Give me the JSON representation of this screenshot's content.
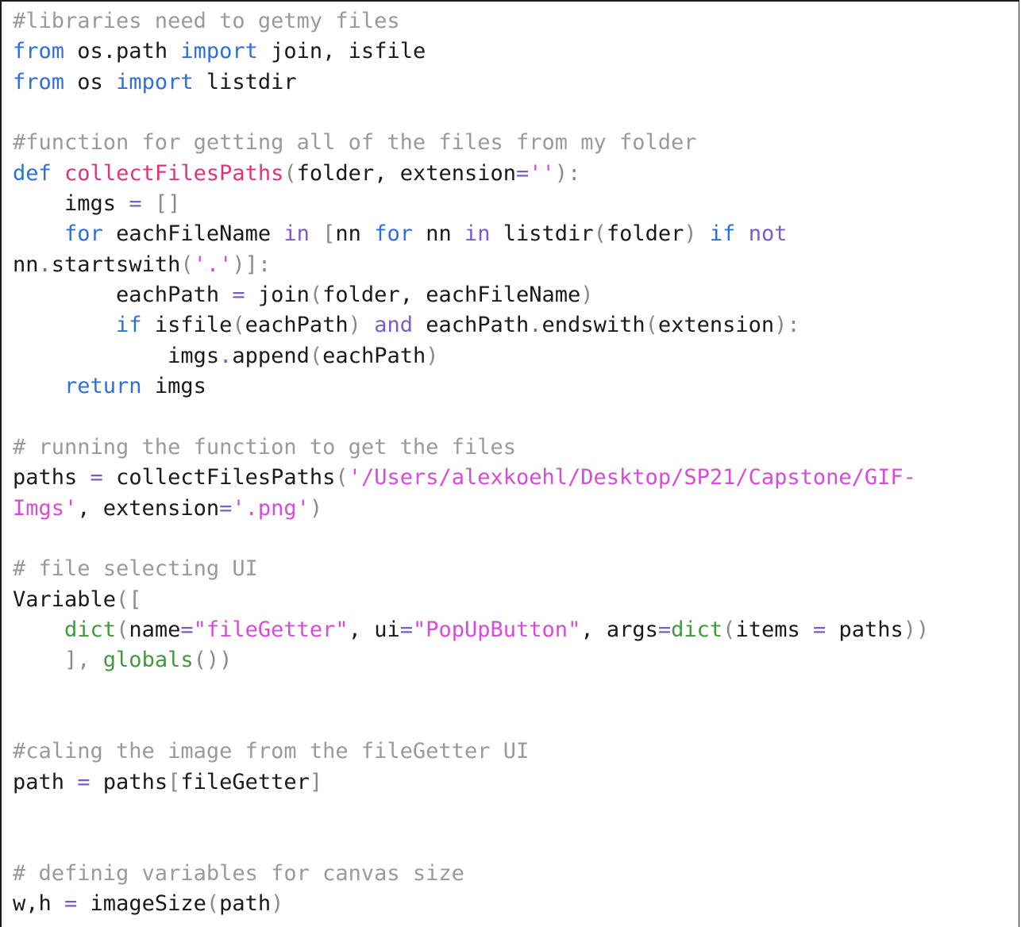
{
  "editor": {
    "lines": [
      [
        {
          "t": "#libraries need to getmy files",
          "c": "comment"
        }
      ],
      [
        {
          "t": "from",
          "c": "keyword"
        },
        {
          "t": " os.path ",
          "c": "plain"
        },
        {
          "t": "import",
          "c": "keyword"
        },
        {
          "t": " join, isfile",
          "c": "plain"
        }
      ],
      [
        {
          "t": "from",
          "c": "keyword"
        },
        {
          "t": " os ",
          "c": "plain"
        },
        {
          "t": "import",
          "c": "keyword"
        },
        {
          "t": " listdir",
          "c": "plain"
        }
      ],
      [],
      [
        {
          "t": "#function for getting all of the files from my folder",
          "c": "comment"
        }
      ],
      [
        {
          "t": "def",
          "c": "keyword"
        },
        {
          "t": " ",
          "c": "plain"
        },
        {
          "t": "collectFilesPaths",
          "c": "funcdef"
        },
        {
          "t": "(",
          "c": "punct"
        },
        {
          "t": "folder, extension",
          "c": "plain"
        },
        {
          "t": "=",
          "c": "op"
        },
        {
          "t": "''",
          "c": "string"
        },
        {
          "t": "):",
          "c": "punct"
        }
      ],
      [
        {
          "t": "    imgs ",
          "c": "plain"
        },
        {
          "t": "=",
          "c": "op"
        },
        {
          "t": " []",
          "c": "punct"
        }
      ],
      [
        {
          "t": "    ",
          "c": "plain"
        },
        {
          "t": "for",
          "c": "keyword"
        },
        {
          "t": " eachFileName ",
          "c": "plain"
        },
        {
          "t": "in",
          "c": "op"
        },
        {
          "t": " [",
          "c": "punct"
        },
        {
          "t": "nn ",
          "c": "plain"
        },
        {
          "t": "for",
          "c": "keyword"
        },
        {
          "t": " nn ",
          "c": "plain"
        },
        {
          "t": "in",
          "c": "op"
        },
        {
          "t": " listdir",
          "c": "plain"
        },
        {
          "t": "(",
          "c": "punct"
        },
        {
          "t": "folder",
          "c": "plain"
        },
        {
          "t": ") ",
          "c": "punct"
        },
        {
          "t": "if",
          "c": "keyword"
        },
        {
          "t": " ",
          "c": "plain"
        },
        {
          "t": "not",
          "c": "op"
        }
      ],
      [
        {
          "t": "nn",
          "c": "plain"
        },
        {
          "t": ".",
          "c": "op"
        },
        {
          "t": "startswith",
          "c": "plain"
        },
        {
          "t": "(",
          "c": "punct"
        },
        {
          "t": "'.'",
          "c": "string"
        },
        {
          "t": ")]:",
          "c": "punct"
        }
      ],
      [
        {
          "t": "        eachPath ",
          "c": "plain"
        },
        {
          "t": "=",
          "c": "op"
        },
        {
          "t": " join",
          "c": "plain"
        },
        {
          "t": "(",
          "c": "punct"
        },
        {
          "t": "folder, eachFileName",
          "c": "plain"
        },
        {
          "t": ")",
          "c": "punct"
        }
      ],
      [
        {
          "t": "        ",
          "c": "plain"
        },
        {
          "t": "if",
          "c": "keyword"
        },
        {
          "t": " isfile",
          "c": "plain"
        },
        {
          "t": "(",
          "c": "punct"
        },
        {
          "t": "eachPath",
          "c": "plain"
        },
        {
          "t": ") ",
          "c": "punct"
        },
        {
          "t": "and",
          "c": "op"
        },
        {
          "t": " eachPath",
          "c": "plain"
        },
        {
          "t": ".",
          "c": "op"
        },
        {
          "t": "endswith",
          "c": "plain"
        },
        {
          "t": "(",
          "c": "punct"
        },
        {
          "t": "extension",
          "c": "plain"
        },
        {
          "t": "):",
          "c": "punct"
        }
      ],
      [
        {
          "t": "            imgs",
          "c": "plain"
        },
        {
          "t": ".",
          "c": "op"
        },
        {
          "t": "append",
          "c": "plain"
        },
        {
          "t": "(",
          "c": "punct"
        },
        {
          "t": "eachPath",
          "c": "plain"
        },
        {
          "t": ")",
          "c": "punct"
        }
      ],
      [
        {
          "t": "    ",
          "c": "plain"
        },
        {
          "t": "return",
          "c": "keyword"
        },
        {
          "t": " imgs",
          "c": "plain"
        }
      ],
      [],
      [
        {
          "t": "# running the function to get the files",
          "c": "comment"
        }
      ],
      [
        {
          "t": "paths ",
          "c": "plain"
        },
        {
          "t": "=",
          "c": "op"
        },
        {
          "t": " collectFilesPaths",
          "c": "plain"
        },
        {
          "t": "(",
          "c": "punct"
        },
        {
          "t": "'/Users/alexkoehl/Desktop/SP21/Capstone/GIF-",
          "c": "string"
        }
      ],
      [
        {
          "t": "Imgs'",
          "c": "string"
        },
        {
          "t": ", extension",
          "c": "plain"
        },
        {
          "t": "=",
          "c": "op"
        },
        {
          "t": "'.png'",
          "c": "string"
        },
        {
          "t": ")",
          "c": "punct"
        }
      ],
      [],
      [
        {
          "t": "# file selecting UI",
          "c": "comment"
        }
      ],
      [
        {
          "t": "Variable",
          "c": "plain"
        },
        {
          "t": "([",
          "c": "punct"
        }
      ],
      [
        {
          "t": "    ",
          "c": "plain"
        },
        {
          "t": "dict",
          "c": "builtin"
        },
        {
          "t": "(",
          "c": "punct"
        },
        {
          "t": "name",
          "c": "plain"
        },
        {
          "t": "=",
          "c": "op"
        },
        {
          "t": "\"fileGetter\"",
          "c": "string"
        },
        {
          "t": ", ui",
          "c": "plain"
        },
        {
          "t": "=",
          "c": "op"
        },
        {
          "t": "\"PopUpButton\"",
          "c": "string"
        },
        {
          "t": ", args",
          "c": "plain"
        },
        {
          "t": "=",
          "c": "op"
        },
        {
          "t": "dict",
          "c": "builtin"
        },
        {
          "t": "(",
          "c": "punct"
        },
        {
          "t": "items ",
          "c": "plain"
        },
        {
          "t": "=",
          "c": "op"
        },
        {
          "t": " paths",
          "c": "plain"
        },
        {
          "t": "))",
          "c": "punct"
        }
      ],
      [
        {
          "t": "    ], ",
          "c": "punct"
        },
        {
          "t": "globals",
          "c": "builtin"
        },
        {
          "t": "())",
          "c": "punct"
        }
      ],
      [],
      [],
      [
        {
          "t": "#caling the image from the fileGetter UI",
          "c": "comment"
        }
      ],
      [
        {
          "t": "path ",
          "c": "plain"
        },
        {
          "t": "=",
          "c": "op"
        },
        {
          "t": " paths",
          "c": "plain"
        },
        {
          "t": "[",
          "c": "punct"
        },
        {
          "t": "fileGetter",
          "c": "plain"
        },
        {
          "t": "]",
          "c": "punct"
        }
      ],
      [],
      [],
      [
        {
          "t": "# definig variables for canvas size",
          "c": "comment"
        }
      ],
      [
        {
          "t": "w,h ",
          "c": "plain"
        },
        {
          "t": "=",
          "c": "op"
        },
        {
          "t": " imageSize",
          "c": "plain"
        },
        {
          "t": "(",
          "c": "punct"
        },
        {
          "t": "path",
          "c": "plain"
        },
        {
          "t": ")",
          "c": "punct"
        }
      ]
    ]
  }
}
